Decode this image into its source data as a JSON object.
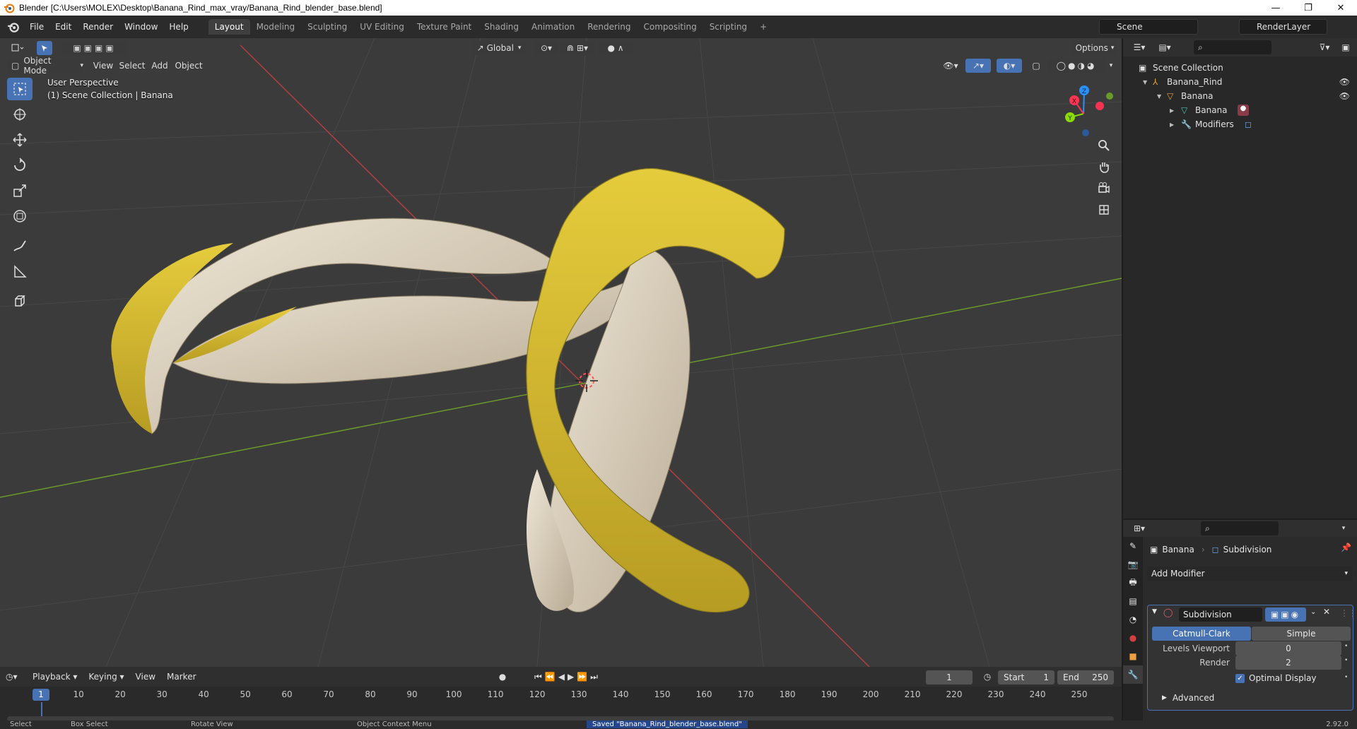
{
  "window": {
    "title": "Blender [C:\\Users\\MOLEX\\Desktop\\Banana_Rind_max_vray/Banana_Rind_blender_base.blend]",
    "minimize": "—",
    "maximize": "❐",
    "close": "✕"
  },
  "menubar": {
    "items": [
      "File",
      "Edit",
      "Render",
      "Window",
      "Help"
    ]
  },
  "workspaces": {
    "tabs": [
      "Layout",
      "Modeling",
      "Sculpting",
      "UV Editing",
      "Texture Paint",
      "Shading",
      "Animation",
      "Rendering",
      "Compositing",
      "Scripting"
    ],
    "active": "Layout",
    "add": "+"
  },
  "scene": {
    "name": "Scene",
    "render_layer": "RenderLayer"
  },
  "viewport": {
    "mode": "Object Mode",
    "menus": [
      "View",
      "Select",
      "Add",
      "Object"
    ],
    "transform_orientation": "Global",
    "options_label": "Options",
    "perspective_label": "User Perspective",
    "collection_label": "(1) Scene Collection | Banana",
    "gizmo_axes": {
      "x": "X",
      "y": "Y",
      "z": "Z"
    }
  },
  "toolbar": {
    "tools": [
      "select-box",
      "cursor",
      "move",
      "rotate",
      "scale",
      "transform",
      "annotate",
      "measure",
      "add-cube"
    ],
    "active": "select-box"
  },
  "timeline": {
    "menus": [
      "Playback",
      "Keying",
      "View",
      "Marker"
    ],
    "current_frame": "1",
    "start_label": "Start",
    "start": "1",
    "end_label": "End",
    "end": "250",
    "ruler_ticks": [
      "1",
      "10",
      "20",
      "30",
      "40",
      "50",
      "60",
      "70",
      "80",
      "90",
      "100",
      "110",
      "120",
      "130",
      "140",
      "150",
      "160",
      "170",
      "180",
      "190",
      "200",
      "210",
      "220",
      "230",
      "240",
      "250"
    ]
  },
  "outliner": {
    "root": "Scene Collection",
    "items": [
      {
        "name": "Banana_Rind",
        "level": 1,
        "icon": "empty-icon"
      },
      {
        "name": "Banana",
        "level": 2,
        "icon": "object-icon"
      },
      {
        "name": "Banana",
        "level": 3,
        "icon": "mesh-icon"
      },
      {
        "name": "Modifiers",
        "level": 3,
        "icon": "wrench-icon"
      }
    ]
  },
  "properties": {
    "object_name": "Banana",
    "modifier_context": "Subdivision",
    "add_modifier": "Add Modifier",
    "modifier": {
      "name": "Subdivision",
      "type_options": [
        "Catmull-Clark",
        "Simple"
      ],
      "type_selected": "Catmull-Clark",
      "levels_viewport_label": "Levels Viewport",
      "levels_viewport": "0",
      "render_label": "Render",
      "render": "2",
      "optimal_display_label": "Optimal Display",
      "optimal_display": true,
      "advanced_label": "Advanced"
    }
  },
  "statusbar": {
    "items": [
      "Select",
      "Box Select",
      "Rotate View",
      "Object Context Menu"
    ],
    "message": "Saved \"Banana_Rind_blender_base.blend\"",
    "version": "2.92.0"
  },
  "colors": {
    "accent": "#4772b3",
    "axis_x": "#ff3352",
    "axis_y": "#8bdc00",
    "axis_z": "#2890ff",
    "viewport_bg": "#3b3b3b",
    "banana_yellow": "#d9c13a"
  }
}
